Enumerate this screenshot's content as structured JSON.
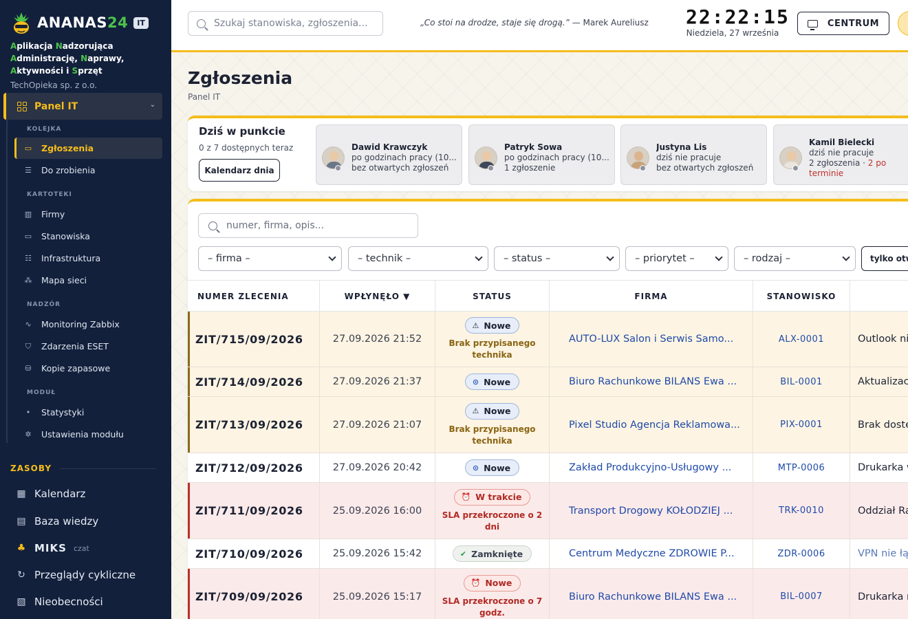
{
  "brand": {
    "name_main": "ANANAS",
    "name_num": "24",
    "badge": "IT",
    "company": "TechOpieka sp. z o.o."
  },
  "tagline": [
    {
      "hl": "A",
      "rest": "plikacja "
    },
    {
      "hl": "N",
      "rest": "adzorująca "
    },
    {
      "hl": "A",
      "rest": "dministrację,"
    },
    {
      "hl": "N",
      "rest": "aprawy, "
    },
    {
      "hl": "A",
      "rest": "ktywności i "
    },
    {
      "hl": "S",
      "rest": "przęt"
    }
  ],
  "sidebar": {
    "panel": "Panel IT",
    "sections": {
      "kolejka": "KOLEJKA",
      "kartoteki": "KARTOTEKI",
      "nadzor": "NADZÓR",
      "modul": "MODUŁ"
    },
    "items": {
      "zgloszenia": "Zgłoszenia",
      "do_zrobienia": "Do zrobienia",
      "firmy": "Firmy",
      "stanowiska": "Stanowiska",
      "infrastruktura": "Infrastruktura",
      "mapa": "Mapa sieci",
      "zabbix": "Monitoring Zabbix",
      "eset": "Zdarzenia ESET",
      "kopie": "Kopie zapasowe",
      "statystyki": "Statystyki",
      "ustawienia": "Ustawienia modułu"
    },
    "zasoby": "ZASOBY",
    "resources": {
      "kalendarz": "Kalendarz",
      "baza": "Baza wiedzy",
      "miks": "MIKS",
      "miks_sub": "czat",
      "przeglady": "Przeglądy cykliczne",
      "nieobecnosci": "Nieobecności"
    }
  },
  "topbar": {
    "search_placeholder": "Szukaj stanowiska, zgłoszenia...",
    "quote": "„Co stoi na drodze, staje się drogą.”",
    "quote_author": "— Marek Aureliusz",
    "time": "22:22:15",
    "date": "Niedziela, 27 września",
    "centrum": "CENTRUM"
  },
  "page": {
    "title": "Zgłoszenia",
    "breadcrumb": "Panel IT"
  },
  "today": {
    "title": "Dziś w punkcie",
    "available": "0 z 7 dostępnych teraz",
    "calendar_btn": "Kalendarz dnia",
    "techs": [
      {
        "name": "Dawid Krawczyk",
        "l1": "po godzinach pracy (10...",
        "l2": "bez otwartych zgłoszeń",
        "l2b": ""
      },
      {
        "name": "Patryk Sowa",
        "l1": "po godzinach pracy (10...",
        "l2": "1 zgłoszenie",
        "l2b": ""
      },
      {
        "name": "Justyna Lis",
        "l1": "dziś nie pracuje",
        "l2": "bez otwartych zgłoszeń",
        "l2b": ""
      },
      {
        "name": "Kamil Bielecki",
        "l1": "dziś nie pracuje",
        "l2": "2 zgłoszenia · ",
        "l2b": "2 po terminie"
      }
    ]
  },
  "tickets": {
    "search_placeholder": "numer, firma, opis...",
    "filters": [
      "– firma –",
      "– technik –",
      "– status –",
      "– priorytet –",
      "– rodzaj –"
    ],
    "only_open": "tylko otwarte",
    "columns": {
      "num": "NUMER ZLECENIA",
      "date": "WPŁYNĘŁO ▼",
      "status": "STATUS",
      "firm": "FIRMA",
      "stan": "STANOWISKO"
    },
    "rows": [
      {
        "num": "ZIT/715/09/2026",
        "date": "27.09.2026 21:52",
        "status": "Nowe",
        "sub": "Brak przypisanego technika",
        "firm": "AUTO-LUX Salon i Serwis Samo...",
        "stan": "ALX-0001",
        "desc": "Outlook nie"
      },
      {
        "num": "ZIT/714/09/2026",
        "date": "27.09.2026 21:37",
        "status": "Nowe",
        "sub": "",
        "firm": "Biuro Rachunkowe BILANS Ewa ...",
        "stan": "BIL-0001",
        "desc": "Aktualizacja"
      },
      {
        "num": "ZIT/713/09/2026",
        "date": "27.09.2026 21:07",
        "status": "Nowe",
        "sub": "Brak przypisanego technika",
        "firm": "Pixel Studio Agencja Reklamowa...",
        "stan": "PIX-0001",
        "desc": "Brak dostęp"
      },
      {
        "num": "ZIT/712/09/2026",
        "date": "27.09.2026 20:42",
        "status": "Nowe",
        "sub": "",
        "firm": "Zakład Produkcyjno-Usługowy ...",
        "stan": "MTP-0006",
        "desc": "Drukarka w"
      },
      {
        "num": "ZIT/711/09/2026",
        "date": "25.09.2026 16:00",
        "status": "W trakcie",
        "sub": "SLA przekroczone o 2 dni",
        "firm": "Transport Drogowy KOŁODZIEJ ...",
        "stan": "TRK-0010",
        "desc": "Oddział Ra"
      },
      {
        "num": "ZIT/710/09/2026",
        "date": "25.09.2026 15:42",
        "status": "Zamknięte",
        "sub": "",
        "firm": "Centrum Medyczne ZDROWIE P...",
        "stan": "ZDR-0006",
        "desc": "VPN nie łą"
      },
      {
        "num": "ZIT/709/09/2026",
        "date": "25.09.2026 15:17",
        "status": "Nowe",
        "sub": "SLA przekroczone o 7 godz.",
        "firm": "Biuro Rachunkowe BILANS Ewa ...",
        "stan": "BIL-0007",
        "desc": "Drukarka n"
      }
    ]
  }
}
